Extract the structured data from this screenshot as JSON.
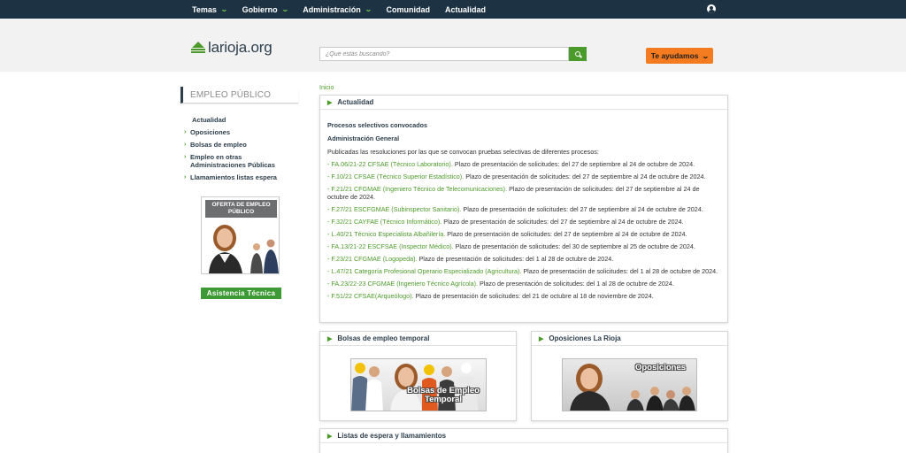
{
  "topnav": {
    "items": [
      {
        "label": "Temas",
        "has_dropdown": true
      },
      {
        "label": "Gobierno",
        "has_dropdown": true
      },
      {
        "label": "Administración",
        "has_dropdown": true
      },
      {
        "label": "Comunidad",
        "has_dropdown": false
      },
      {
        "label": "Actualidad",
        "has_dropdown": false
      }
    ],
    "user_icon": "user-circle-icon",
    "colors": {
      "background": "#1d3344",
      "chevron": "#6abf4b"
    }
  },
  "header": {
    "logo_text": "larioja.org",
    "search": {
      "placeholder": "¿Qué estás buscando?",
      "value": ""
    },
    "help_button": "Te ayudamos",
    "colors": {
      "accent_green": "#4b9a2c",
      "help_orange": "#f47b20"
    }
  },
  "sidebar": {
    "title": "EMPLEO PÚBLICO",
    "items": [
      {
        "label": "Actualidad",
        "active": true
      },
      {
        "label": "Oposiciones",
        "active": false
      },
      {
        "label": "Bolsas de empleo",
        "active": false
      },
      {
        "label": "Empleo en otras Administraciones Públicas",
        "active": false
      },
      {
        "label": "Llamamientos listas espera",
        "active": false
      }
    ],
    "banner_label": "OFERTA DE EMPLEO PÚBLICO",
    "assist_button": "Asistencia Técnica"
  },
  "main": {
    "breadcrumb": "Inicio",
    "actualidad": {
      "title": "Actualidad",
      "heading": "Procesos selectivos convocados",
      "subheading": "Administración General",
      "intro": "Publicadas las resoluciones por las que se convocan pruebas selectivas de diferentes procesos:",
      "items": [
        {
          "link": "- FA.06/21-22 CFSAE (Técnico Laboratorio).",
          "text": " Plazo de presentación de solicitudes: del 27 de septiembre al 24 de octubre de 2024."
        },
        {
          "link": "- F.10/21 CFSAE (Técnico Superior Estadístico).",
          "text": " Plazo de presentación de solicitudes: del 27 de septiembre al 24 de octubre de 2024."
        },
        {
          "link": "- F.21/21 CFGMAE (Ingeniero Técnico de Telecomunicaciones).",
          "text": " Plazo de presentación de solicitudes: del 27 de septiembre al 24 de octubre de 2024."
        },
        {
          "link": "- F.27/21 ESCFGMAE (Subinspector Sanitario).",
          "text": " Plazo de presentación de solicitudes: del 27 de septiembre al 24 de octubre de 2024."
        },
        {
          "link": "- F.32/21 CAYFAE (Técnico Informático).",
          "text": " Plazo de presentación de solicitudes: del 27 de septiembre al 24 de octubre de 2024."
        },
        {
          "link": "- L.40/21 Técnico Especialista Albañilería.",
          "text": " Plazo de presentación de solicitudes: del 27 de septiembre al 24 de octubre de 2024."
        },
        {
          "link": "- FA.13/21-22 ESCFSAE (Inspector Médico).",
          "text": " Plazo de presentación de solicitudes: del 30 de septiembre al 25 de octubre de 2024."
        },
        {
          "link": "- F.23/21 CFGMAE (Logopeda).",
          "text": " Plazo de presentación de solicitudes: del 1 al 28 de octubre de 2024."
        },
        {
          "link": "- L.47/21 Categoría Profesional Operario Especializado (Agricultura).",
          "text": " Plazo de presentación de solicitudes: del 1 al 28 de octubre de 2024."
        },
        {
          "link": "- FA.23/22-23 CFGMAE (Ingeniero Técnico Agrícola).",
          "text": " Plazo de presentación de solicitudes: del 1 al 28 de octubre de 2024."
        },
        {
          "link": "- F.51/22 CFSAE(Arqueólogo).",
          "text": " Plazo de presentación de solicitudes: del 21 de octubre al 18 de noviembre de 2024."
        }
      ]
    },
    "bolsas": {
      "title": "Bolsas de empleo temporal",
      "image_caption": "Bolsas de Empleo Temporal"
    },
    "oposiciones": {
      "title": "Oposiciones La Rioja",
      "image_caption": "Oposiciones"
    },
    "listas": {
      "title": "Listas de espera y llamamientos"
    }
  }
}
